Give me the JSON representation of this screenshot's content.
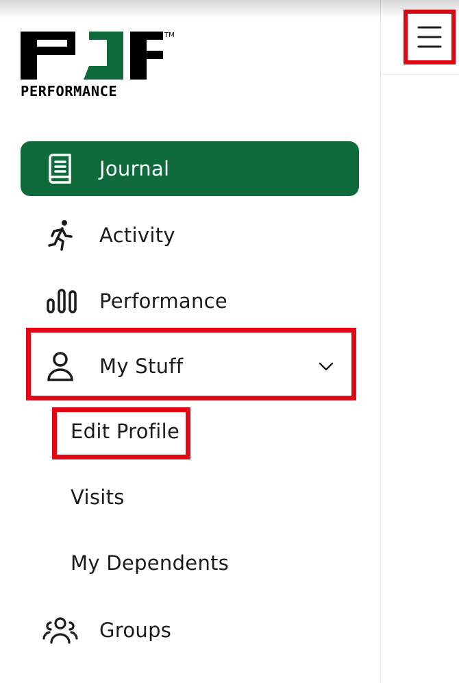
{
  "brand": {
    "logo_letters": "PJF",
    "logo_sub": "PERFORMANCE",
    "trademark": "TM",
    "green": "#0f6b3b"
  },
  "sidebar": {
    "items": [
      {
        "label": "Journal",
        "icon": "journal-book-icon",
        "active": true
      },
      {
        "label": "Activity",
        "icon": "running-person-icon",
        "active": false
      },
      {
        "label": "Performance",
        "icon": "bar-chart-icon",
        "active": false
      },
      {
        "label": "My Stuff",
        "icon": "user-icon",
        "active": false,
        "expanded": true,
        "children": [
          "Edit Profile",
          "Visits",
          "My Dependents"
        ]
      },
      {
        "label": "Groups",
        "icon": "group-icon",
        "active": false
      }
    ]
  },
  "topbar": {
    "menu_icon": "hamburger-menu-icon"
  },
  "colors": {
    "highlight": "#e30613",
    "active_bg": "#0f6b3b"
  }
}
